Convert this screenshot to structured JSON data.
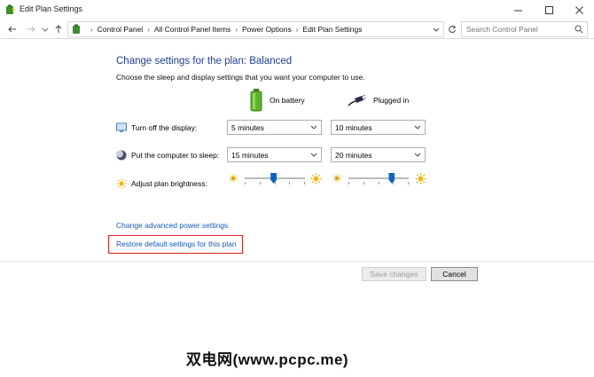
{
  "window": {
    "title": "Edit Plan Settings",
    "icon": "power-plan-icon",
    "controls": [
      "minimize-icon",
      "maximize-icon",
      "close-icon"
    ]
  },
  "nav": {
    "back_icon": "arrow-left-icon",
    "forward_icon": "arrow-right-icon",
    "recent_icon": "chevron-down-icon",
    "up_icon": "arrow-up-icon",
    "refresh_icon": "refresh-icon"
  },
  "breadcrumbs": [
    "Control Panel",
    "All Control Panel Items",
    "Power Options",
    "Edit Plan Settings"
  ],
  "search": {
    "placeholder": "Search Control Panel"
  },
  "main": {
    "heading": "Change settings for the plan: Balanced",
    "subtext": "Choose the sleep and display settings that you want your computer to use.",
    "columns": {
      "on_battery": "On battery",
      "plugged_in": "Plugged in"
    },
    "rows": {
      "display": {
        "label": "Turn off the display:",
        "battery": "5 minutes",
        "plugged": "10 minutes"
      },
      "sleep": {
        "label": "Put the computer to sleep:",
        "battery": "15 minutes",
        "plugged": "20 minutes"
      },
      "brightness": {
        "label": "Adjust plan brightness:",
        "battery_level": 0.48,
        "plugged_level": 0.72
      }
    },
    "links": {
      "advanced": "Change advanced power settings",
      "restore": "Restore default settings for this plan"
    }
  },
  "buttons": {
    "save": "Save changes",
    "cancel": "Cancel"
  },
  "watermark": "双电网(www.pcpc.me)",
  "colors": {
    "heading": "#1e3d8f",
    "link": "#1759b8",
    "highlight_box": "#e02020",
    "slider_thumb": "#0b63c4"
  }
}
